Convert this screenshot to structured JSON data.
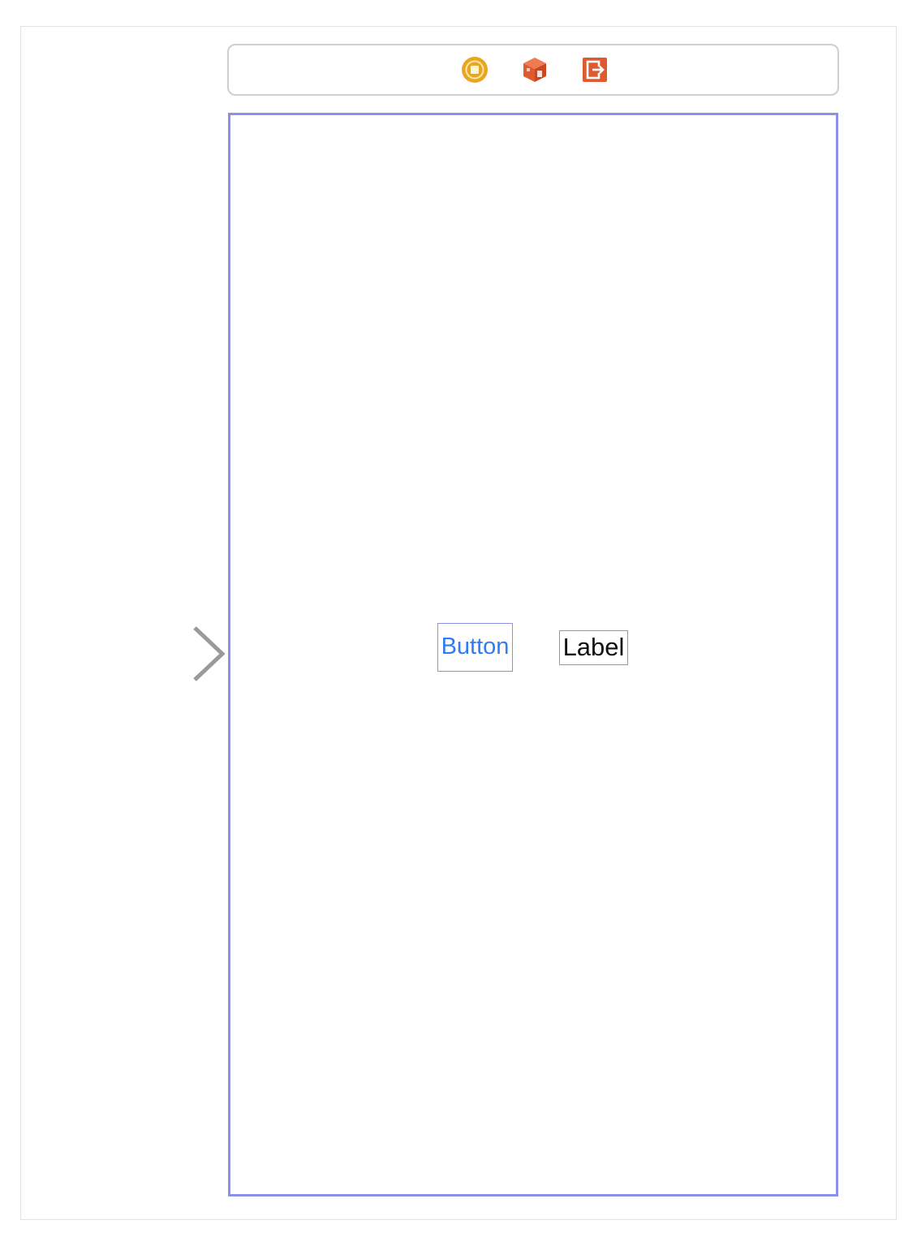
{
  "scene_dock": {
    "icons": [
      {
        "name": "view-controller-icon",
        "color": "#e8a623"
      },
      {
        "name": "first-responder-icon",
        "color": "#e05a30"
      },
      {
        "name": "exit-icon",
        "color": "#e05a30"
      }
    ]
  },
  "canvas": {
    "entry_point": "storyboard-entry-arrow-icon",
    "button": {
      "label": "Button",
      "color": "#2f7cf6"
    },
    "label": {
      "text": "Label",
      "color": "#111111"
    },
    "selection_color": "#8e91ea"
  }
}
